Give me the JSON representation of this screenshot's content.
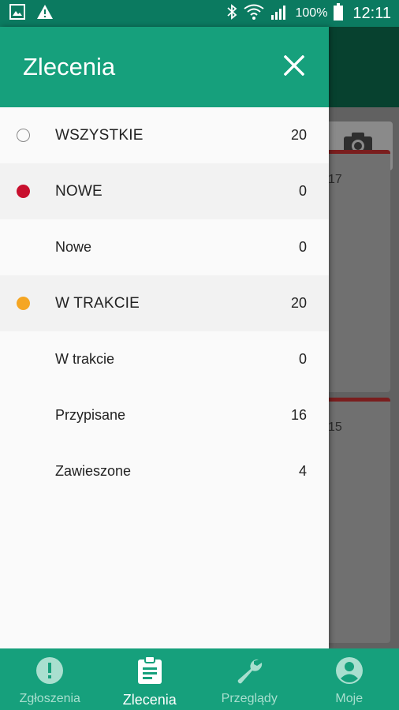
{
  "status_bar": {
    "battery": "100%",
    "time": "12:11",
    "icons": [
      "image-icon",
      "warning-icon",
      "bluetooth-icon",
      "wifi-icon",
      "signal-icon",
      "battery-icon"
    ]
  },
  "background": {
    "card1_text": "17",
    "card2_text": "15"
  },
  "drawer": {
    "title": "Zlecenia",
    "items": [
      {
        "label": "WSZYSTKIE",
        "count": "20",
        "dot": "outline"
      },
      {
        "label": "NOWE",
        "count": "0",
        "dot": "#c8102e"
      },
      {
        "label": "Nowe",
        "count": "0"
      },
      {
        "label": "W TRAKCIE",
        "count": "20",
        "dot": "#f5a623"
      },
      {
        "label": "W trakcie",
        "count": "0"
      },
      {
        "label": "Przypisane",
        "count": "16"
      },
      {
        "label": "Zawieszone",
        "count": "4"
      }
    ]
  },
  "bottom_nav": {
    "items": [
      {
        "label": "Zgłoszenia",
        "icon": "exclamation-icon"
      },
      {
        "label": "Zlecenia",
        "icon": "clipboard-icon",
        "active": true
      },
      {
        "label": "Przeglądy",
        "icon": "wrench-icon"
      },
      {
        "label": "Moje",
        "icon": "account-icon"
      }
    ]
  },
  "colors": {
    "primary": "#16a07c",
    "status_bar": "#0b7a60",
    "new_dot": "#c8102e",
    "in_progress_dot": "#f5a623"
  }
}
